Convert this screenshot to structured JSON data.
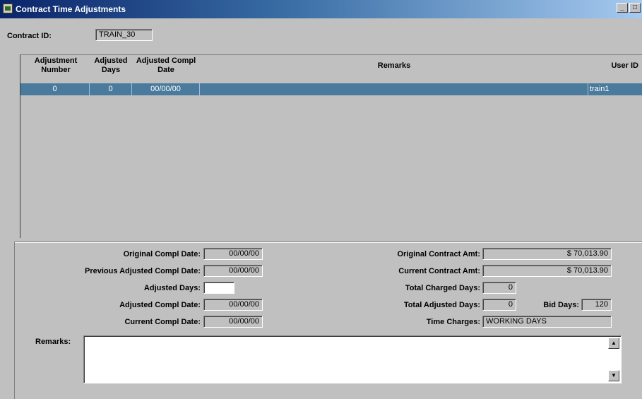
{
  "window": {
    "title": "Contract Time Adjustments",
    "buttons": {
      "minimize": "_",
      "maximize": "□"
    }
  },
  "contract": {
    "label": "Contract ID:",
    "value": "TRAIN_30"
  },
  "grid": {
    "headers": {
      "adjustment_number": "Adjustment Number",
      "adjusted_days": "Adjusted Days",
      "adjusted_compl_date": "Adjusted Compl Date",
      "remarks": "Remarks",
      "user_id": "User ID"
    },
    "rows": [
      {
        "adjustment_number": "0",
        "adjusted_days": "0",
        "adjusted_compl_date": "00/00/00",
        "remarks": "",
        "user_id": "train1"
      }
    ]
  },
  "details": {
    "original_compl_date": {
      "label": "Original Compl Date:",
      "value": "00/00/00"
    },
    "previous_adjusted_compl_date": {
      "label": "Previous Adjusted Compl Date:",
      "value": "00/00/00"
    },
    "adjusted_days": {
      "label": "Adjusted Days:",
      "value": ""
    },
    "adjusted_compl_date": {
      "label": "Adjusted Compl Date:",
      "value": "00/00/00"
    },
    "current_compl_date": {
      "label": "Current Compl Date:",
      "value": "00/00/00"
    },
    "original_contract_amt": {
      "label": "Original Contract Amt:",
      "value": "$ 70,013.90"
    },
    "current_contract_amt": {
      "label": "Current Contract Amt:",
      "value": "$ 70,013.90"
    },
    "total_charged_days": {
      "label": "Total Charged Days:",
      "value": "0"
    },
    "total_adjusted_days": {
      "label": "Total Adjusted Days:",
      "value": "0"
    },
    "bid_days": {
      "label": "Bid Days:",
      "value": "120"
    },
    "time_charges": {
      "label": "Time Charges:",
      "value": "WORKING DAYS"
    },
    "remarks": {
      "label": "Remarks:",
      "value": ""
    }
  },
  "colors": {
    "selected_row": "#4a7b9c",
    "background": "#c0c0c0",
    "titlebar": "#0a246a"
  },
  "icons": {
    "app": "app-icon",
    "scroll_up": "scroll-up-arrow-icon",
    "scroll_down": "scroll-down-arrow-icon"
  }
}
